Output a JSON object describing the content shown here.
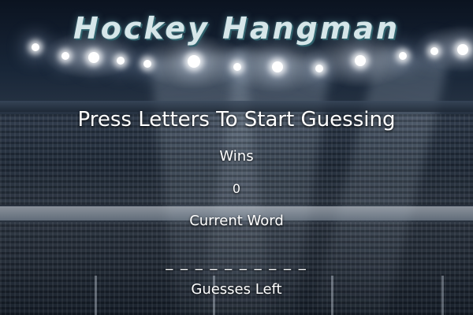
{
  "game": {
    "title": "Hockey Hangman",
    "prompt": "Press Letters To Start Guessing",
    "wins_label": "Wins",
    "wins_value": "0",
    "current_word_label": "Current Word",
    "current_word_display": "_ _ _ _ _ _ _ _ _ _",
    "guesses_left_label": "Guesses Left"
  },
  "colors": {
    "title_text": "#d6e6e9",
    "title_shadow": "#2d5e68",
    "body_text": "#ffffff",
    "background": "#0d1522"
  }
}
